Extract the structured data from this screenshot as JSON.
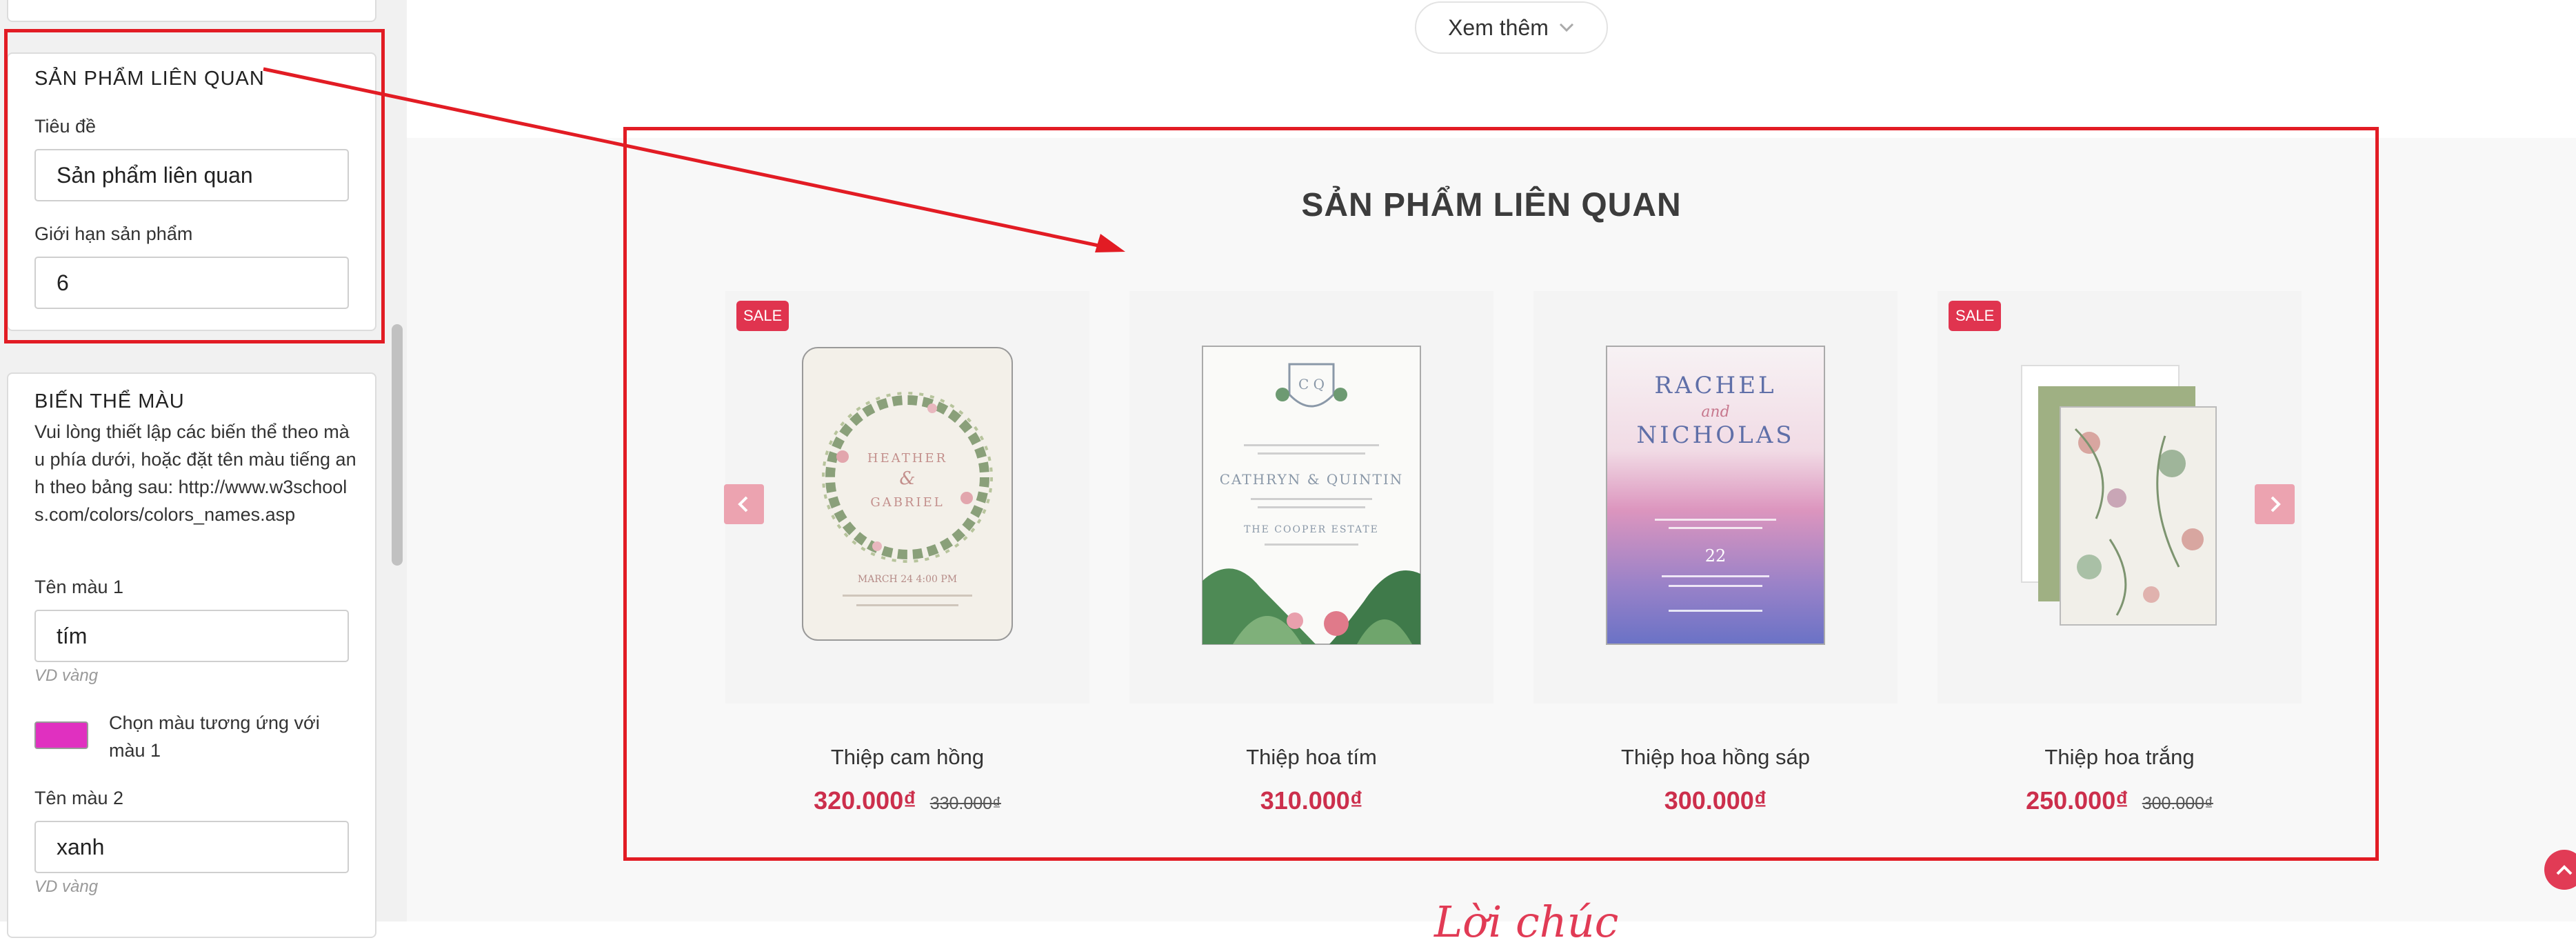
{
  "editor": {
    "related": {
      "section_title": "SẢN PHẨM LIÊN QUAN",
      "title_label": "Tiêu đề",
      "title_value": "Sản phẩm liên quan",
      "limit_label": "Giới hạn sản phẩm",
      "limit_value": "6"
    },
    "variant": {
      "section_title": "BIẾN THỂ MÀU",
      "description": "Vui lòng thiết lập các biến thể theo màu phía dưới, hoặc đặt tên màu tiếng anh theo bảng sau: http://www.w3schools.com/colors/colors_names.asp",
      "color1_label": "Tên màu 1",
      "color1_value": "tím",
      "color1_hint": "VD vàng",
      "color1_picker_label": "Chọn màu tương ứng với màu 1",
      "color1_swatch": "#e030c0",
      "color2_label": "Tên màu 2",
      "color2_value": "xanh",
      "color2_hint": "VD vàng"
    }
  },
  "preview": {
    "see_more_label": "Xem thêm",
    "section_heading": "SẢN PHẨM LIÊN QUAN",
    "script_text": "Lời chúc",
    "products": [
      {
        "name": "Thiệp cam hồng",
        "price": "320.000₫",
        "old_price": "330.000₫",
        "badge": "SALE"
      },
      {
        "name": "Thiệp hoa tím",
        "price": "310.000₫",
        "old_price": "",
        "badge": ""
      },
      {
        "name": "Thiệp hoa hồng sáp",
        "price": "300.000₫",
        "old_price": "",
        "badge": ""
      },
      {
        "name": "Thiệp hoa trắng",
        "price": "250.000₫",
        "old_price": "300.000₫",
        "badge": "SALE"
      }
    ],
    "card_text": {
      "p1_name1": "HEATHER",
      "p1_amp": "&",
      "p1_name2": "GABRIEL",
      "p1_date": "MARCH 24 4:00 PM",
      "p2_monogram": "C Q",
      "p2_names": "CATHRYN & QUINTIN",
      "p2_venue": "THE COOPER ESTATE",
      "p3_name1": "RACHEL",
      "p3_and": "and",
      "p3_name2": "NICHOLAS",
      "p3_date": "22"
    }
  },
  "colors": {
    "accent": "#cc2f4c",
    "sale_badge": "#e0344f",
    "annotation": "#e21c24"
  }
}
